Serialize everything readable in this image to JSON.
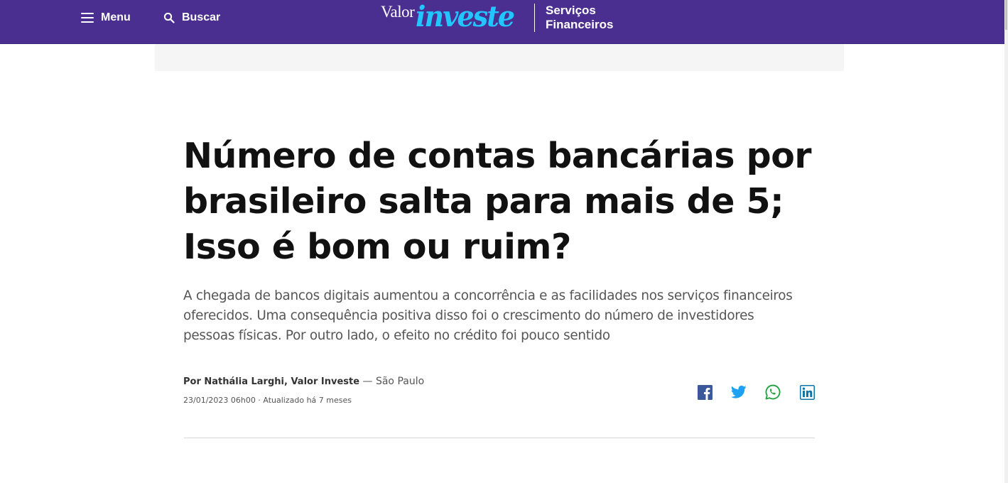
{
  "header": {
    "menu_label": "Menu",
    "search_label": "Buscar",
    "logo_valor": "Valor",
    "logo_investe": "investe",
    "section_line1": "Serviços",
    "section_line2": "Financeiros",
    "background_color": "#4a2f91",
    "logo_accent_color": "#21c6ff"
  },
  "article": {
    "headline": "Número de contas bancárias por brasileiro salta para mais de 5; Isso é bom ou ruim?",
    "subtitle": "A chegada de bancos digitais aumentou a concorrência e as facilidades nos serviços financeiros oferecidos. Uma consequência positiva disso foi o crescimento do número de investidores pessoas físicas. Por outro lado, o efeito no crédito foi pouco sentido",
    "author": "Por Nathália Larghi, Valor Investe",
    "location_separator": " — ",
    "location": "São Paulo",
    "date": "23/01/2023 06h00",
    "updated_separator": " · ",
    "updated": "Atualizado há 7 meses"
  },
  "share": {
    "icons": [
      "facebook-icon",
      "twitter-icon",
      "whatsapp-icon",
      "linkedin-icon"
    ],
    "colors": {
      "facebook": "#3b5998",
      "twitter": "#1da1f2",
      "whatsapp": "#25a344",
      "linkedin": "#0e76a8"
    }
  }
}
